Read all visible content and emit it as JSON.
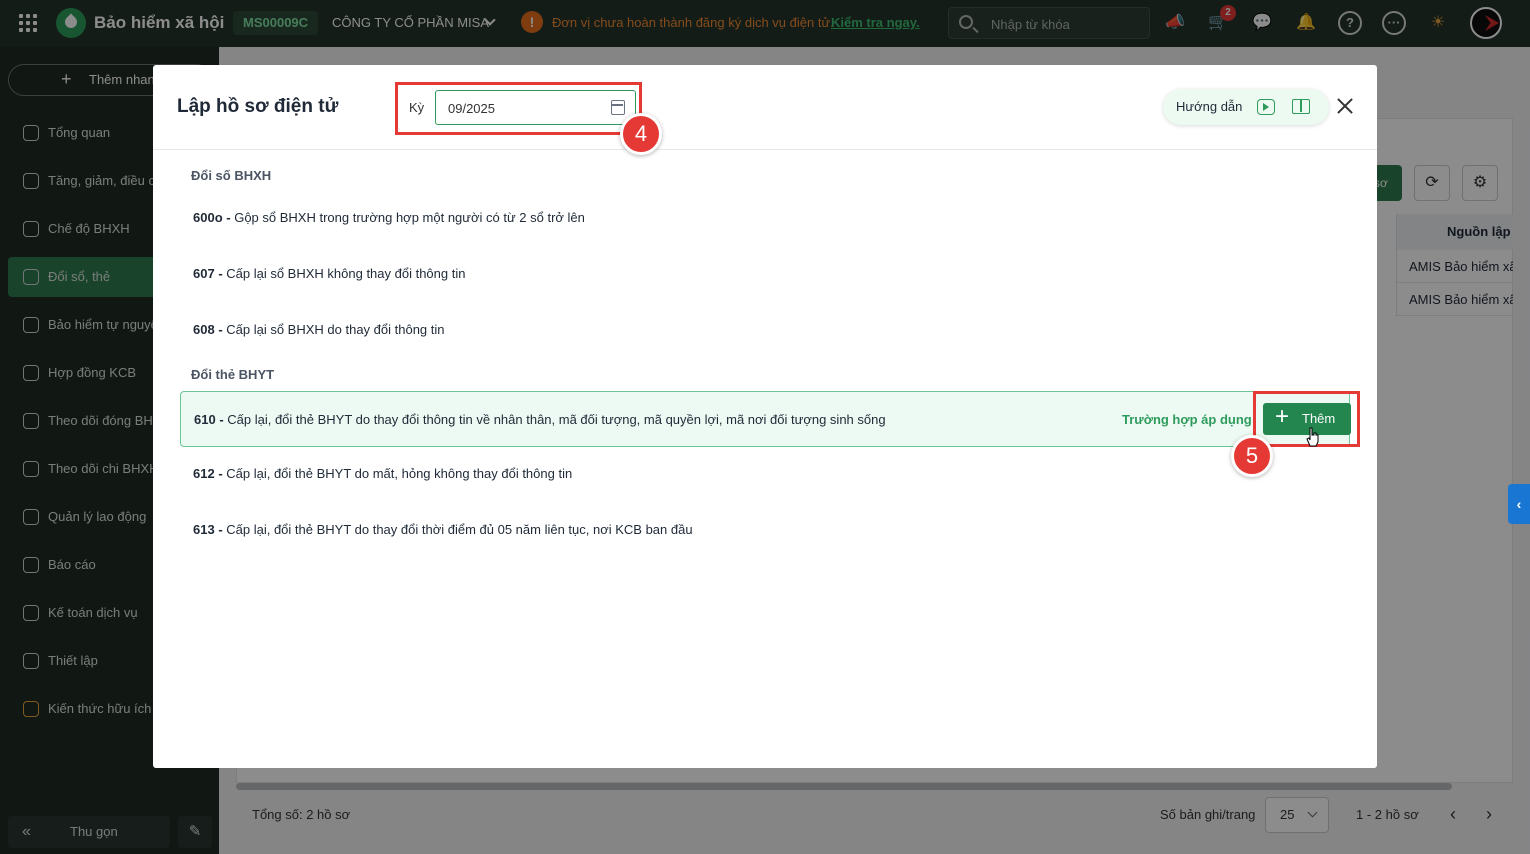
{
  "topbar": {
    "app_title": "Bảo hiểm xã hội",
    "org_code": "MS00009C",
    "company": "CÔNG TY CỔ PHẦN MISA",
    "warning_text": "Đơn vị chưa hoàn thành đăng ký dịch vụ điện tử.",
    "warning_link": "Kiểm tra ngay.",
    "search_placeholder": "Nhập từ khóa",
    "cart_badge": "2",
    "icons": [
      "megaphone-icon",
      "cart-icon",
      "chat-icon",
      "bell-icon",
      "help-icon",
      "more-icon",
      "idea-icon",
      "avatar"
    ]
  },
  "sidebar": {
    "quick_add": "Thêm nhanh",
    "items": [
      {
        "label": "Tổng quan",
        "icon": "home-icon"
      },
      {
        "label": "Tăng, giảm, điều chỉnh",
        "icon": "user-change-icon"
      },
      {
        "label": "Chế độ BHXH",
        "icon": "shield-heart-icon"
      },
      {
        "label": "Đổi sổ, thẻ",
        "icon": "card-icon",
        "active": true
      },
      {
        "label": "Bảo hiểm tự nguyện",
        "icon": "shield-icon"
      },
      {
        "label": "Hợp đồng KCB",
        "icon": "contract-icon"
      },
      {
        "label": "Theo dõi đóng BHXH",
        "icon": "doc-track-icon"
      },
      {
        "label": "Theo dõi chi BHXH",
        "icon": "doc-pay-icon"
      },
      {
        "label": "Quản lý lao động",
        "icon": "people-icon"
      },
      {
        "label": "Báo cáo",
        "icon": "report-icon"
      },
      {
        "label": "Kế toán dịch vụ",
        "icon": "accounting-icon"
      },
      {
        "label": "Thiết lập",
        "icon": "gear-icon"
      },
      {
        "label": "Kiến thức hữu ích",
        "icon": "lightbulb-icon"
      }
    ],
    "collapse": "Thu gọn"
  },
  "background": {
    "green_button_fragment": "sơ",
    "column_header": "Nguồn lập",
    "rows": [
      "AMIS Bảo hiểm xã hội",
      "AMIS Bảo hiểm xã hội"
    ],
    "total": "Tổng số: 2 hồ sơ",
    "per_page_label": "Số bản ghi/trang",
    "per_page_value": "25",
    "range": "1 - 2 hồ sơ"
  },
  "modal": {
    "title": "Lập hồ sơ điện tử",
    "period_label": "Kỳ",
    "period_value": "09/2025",
    "guide_label": "Hướng dẫn",
    "step_period": "4",
    "step_add": "5",
    "sections": [
      {
        "title": "Đổi số BHXH",
        "items": [
          {
            "code": "600o",
            "desc": "Gộp sổ BHXH trong trường hợp một người có từ 2 sổ trở lên"
          },
          {
            "code": "607",
            "desc": "Cấp lại sổ BHXH không thay đổi thông tin"
          },
          {
            "code": "608",
            "desc": "Cấp lại sổ BHXH do thay đổi thông tin"
          }
        ]
      },
      {
        "title": "Đổi thẻ BHYT",
        "items": [
          {
            "code": "610",
            "desc": "Cấp lại, đổi thẻ BHYT do thay đổi thông tin về nhân thân, mã đối tượng, mã quyền lợi, mã nơi đối tượng sinh sống"
          },
          {
            "code": "612",
            "desc": "Cấp lại, đổi thẻ BHYT do mất, hỏng không thay đổi thông tin"
          },
          {
            "code": "613",
            "desc": "Cấp lại, đổi thẻ BHYT do thay đổi thời điểm đủ 05 năm liên tục, nơi KCB ban đầu"
          }
        ]
      }
    ],
    "apply_link": "Trường hợp áp dụng",
    "add_button": "Thêm"
  }
}
